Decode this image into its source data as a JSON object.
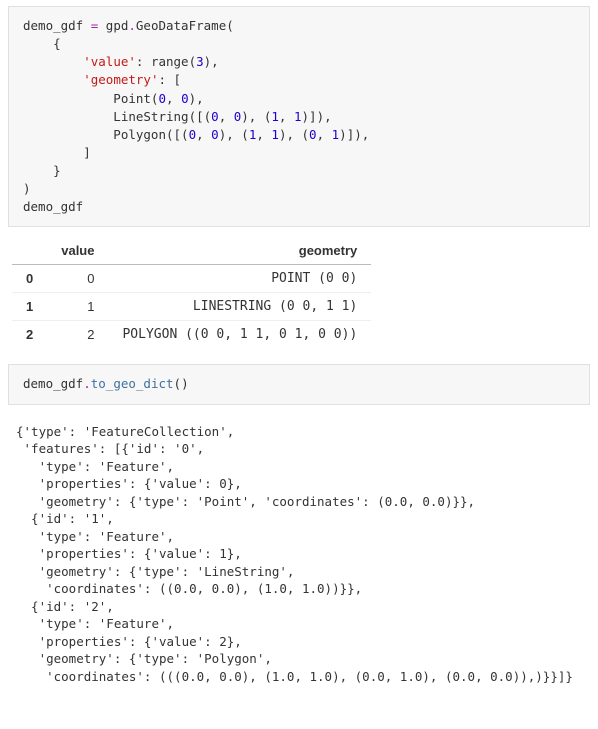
{
  "cell1": {
    "line1a": "demo_gdf ",
    "line1_eq": "=",
    "line1b": " gpd",
    "line1_dot": ".",
    "line1c": "GeoDataFrame(",
    "line2": "    {",
    "line3a": "        ",
    "line3_str": "'value'",
    "line3b": ": range(",
    "line3_num": "3",
    "line3c": "),",
    "line4a": "        ",
    "line4_str": "'geometry'",
    "line4b": ": [",
    "line5a": "            Point(",
    "line5_n1": "0",
    "line5b": ", ",
    "line5_n2": "0",
    "line5c": "),",
    "line6a": "            LineString([(",
    "line6_n1": "0",
    "line6b": ", ",
    "line6_n2": "0",
    "line6c": "), (",
    "line6_n3": "1",
    "line6d": ", ",
    "line6_n4": "1",
    "line6e": ")]),",
    "line7a": "            Polygon([(",
    "line7_n1": "0",
    "line7b": ", ",
    "line7_n2": "0",
    "line7c": "), (",
    "line7_n3": "1",
    "line7d": ", ",
    "line7_n4": "1",
    "line7e": "), (",
    "line7_n5": "0",
    "line7f": ", ",
    "line7_n6": "1",
    "line7g": ")]),",
    "line8": "        ]",
    "line9": "    }",
    "line10": ")",
    "line11": "demo_gdf"
  },
  "table": {
    "col_value": "value",
    "col_geometry": "geometry",
    "rows": [
      {
        "idx": "0",
        "value": "0",
        "geometry": "POINT (0 0)"
      },
      {
        "idx": "1",
        "value": "1",
        "geometry": "LINESTRING (0 0, 1 1)"
      },
      {
        "idx": "2",
        "value": "2",
        "geometry": "POLYGON ((0 0, 1 1, 0 1, 0 0))"
      }
    ]
  },
  "cell2": {
    "pre": "demo_gdf",
    "dot": ".",
    "method": "to_geo_dict",
    "after": "()"
  },
  "output2": "{'type': 'FeatureCollection',\n 'features': [{'id': '0',\n   'type': 'Feature',\n   'properties': {'value': 0},\n   'geometry': {'type': 'Point', 'coordinates': (0.0, 0.0)}},\n  {'id': '1',\n   'type': 'Feature',\n   'properties': {'value': 1},\n   'geometry': {'type': 'LineString',\n    'coordinates': ((0.0, 0.0), (1.0, 1.0))}},\n  {'id': '2',\n   'type': 'Feature',\n   'properties': {'value': 2},\n   'geometry': {'type': 'Polygon',\n    'coordinates': (((0.0, 0.0), (1.0, 1.0), (0.0, 1.0), (0.0, 0.0)),)}}]}"
}
